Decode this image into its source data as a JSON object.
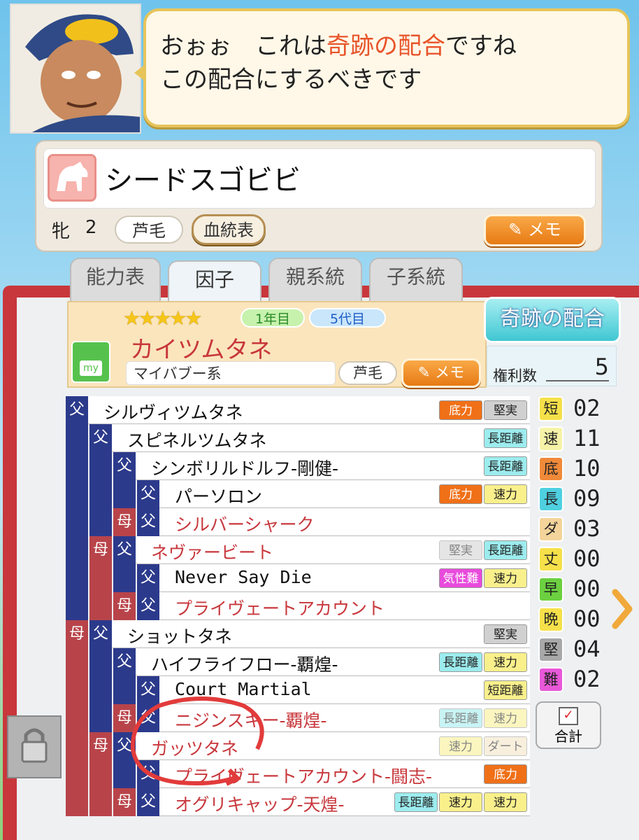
{
  "speech": {
    "line1_a": "おぉぉ　これは",
    "line1_hl": "奇跡の配合",
    "line1_b": "ですね",
    "line2": "この配合にするべきです"
  },
  "horse": {
    "name": "シードスゴビビ",
    "sex": "牝",
    "age": "2",
    "coat": "芦毛",
    "pedigree_btn": "血統表",
    "memo_btn": "メモ"
  },
  "tabs": [
    "能力表",
    "因子",
    "親系統",
    "子系統"
  ],
  "factor": {
    "stars": "★★★★★",
    "year": "1年目",
    "gen": "5代目",
    "name": "カイツムタネ",
    "type": "マイバブー系",
    "coat": "芦毛",
    "memo": "メモ",
    "kiseki": "奇跡の配合",
    "kenri_label": "権利数",
    "kenri_value": "5",
    "my_label": "my"
  },
  "pedigree": [
    {
      "name": "シルヴィツムタネ",
      "color": "black",
      "tags": [
        "底力",
        "堅実"
      ]
    },
    {
      "name": "スピネルツムタネ",
      "color": "black",
      "tags": [
        "長距離"
      ]
    },
    {
      "name": "シンボリルドルフ-剛健-",
      "color": "black",
      "tags": [
        "長距離"
      ]
    },
    {
      "name": "パーソロン",
      "color": "black",
      "tags": [
        "底力",
        "速力"
      ]
    },
    {
      "name": "シルバーシャーク",
      "color": "red",
      "tags": []
    },
    {
      "name": "ネヴァービート",
      "color": "red",
      "tags": [
        "堅実",
        "長距離"
      ]
    },
    {
      "name": "Never Say Die",
      "color": "black",
      "tags": [
        "気性難",
        "速力"
      ]
    },
    {
      "name": "プライヴェートアカウント",
      "color": "red",
      "tags": []
    },
    {
      "name": "ショットタネ",
      "color": "black",
      "tags": [
        "堅実"
      ]
    },
    {
      "name": "ハイフライフロー-覇煌-",
      "color": "black",
      "tags": [
        "長距離",
        "速力"
      ]
    },
    {
      "name": "Court Martial",
      "color": "black",
      "tags": [
        "短距離"
      ]
    },
    {
      "name": "ニジンスキー-覇煌-",
      "color": "red",
      "tags": [
        "長距離",
        "速力"
      ]
    },
    {
      "name": "ガッツタネ",
      "color": "red",
      "tags": [
        "速力",
        "ダート"
      ]
    },
    {
      "name": "プライヴェートアカウント-闘志-",
      "color": "red",
      "tags": [
        "底力"
      ]
    },
    {
      "name": "オグリキャップ-天煌-",
      "color": "red",
      "tags": [
        "長距離",
        "速力",
        "速力"
      ]
    }
  ],
  "labels": {
    "father": "父",
    "mother": "母"
  },
  "stats": [
    {
      "label": "短",
      "value": "02",
      "color": "#f6e04a"
    },
    {
      "label": "速",
      "value": "11",
      "color": "#f6f3a8"
    },
    {
      "label": "底",
      "value": "10",
      "color": "#f08a3a"
    },
    {
      "label": "長",
      "value": "09",
      "color": "#4fd0e0"
    },
    {
      "label": "ダ",
      "value": "03",
      "color": "#f3d49a"
    },
    {
      "label": "丈",
      "value": "00",
      "color": "#f6e04a"
    },
    {
      "label": "早",
      "value": "00",
      "color": "#6cd040"
    },
    {
      "label": "晩",
      "value": "00",
      "color": "#f6e04a"
    },
    {
      "label": "堅",
      "value": "04",
      "color": "#a8a8a8"
    },
    {
      "label": "難",
      "value": "02",
      "color": "#e858d8"
    }
  ],
  "goukei": "合計"
}
